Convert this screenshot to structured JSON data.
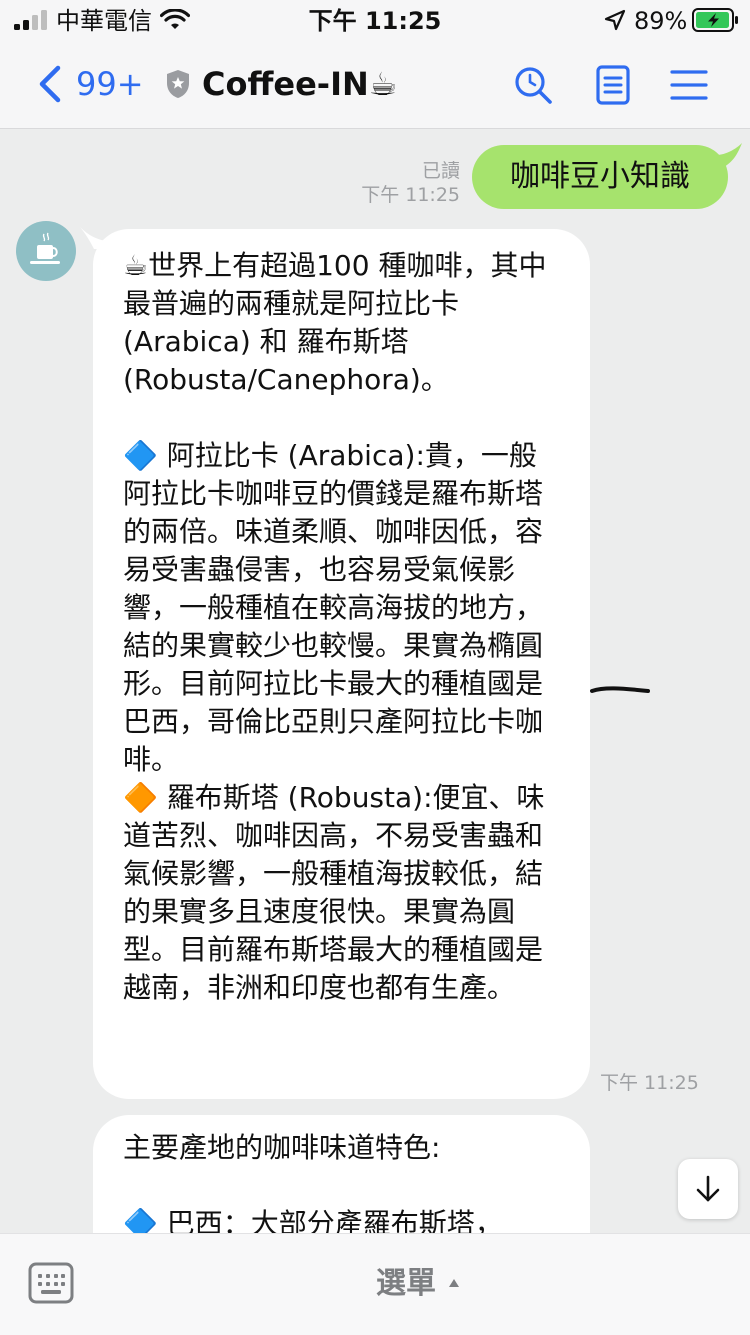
{
  "status_bar": {
    "carrier": "中華電信",
    "time": "下午 11:25",
    "battery_percent": "89%",
    "icons": [
      "signal-icon",
      "wifi-icon",
      "location-arrow-icon",
      "battery-charging-icon"
    ]
  },
  "nav": {
    "unread_count": "99+",
    "chat_title": "Coffee-IN☕",
    "icons": [
      "back-chevron-icon",
      "shield-icon",
      "search-icon",
      "notes-icon",
      "menu-icon"
    ]
  },
  "messages": {
    "outgoing": {
      "read_label": "已讀",
      "time": "下午 11:25",
      "text": "咖啡豆小知識"
    },
    "incoming_1": {
      "text": "☕世界上有超過100 種咖啡，其中最普遍的兩種就是阿拉比卡 (Arabica) 和 羅布斯塔 (Robusta/Canephora)。\n\n🔷 阿拉比卡 (Arabica):貴，一般阿拉比卡咖啡豆的價錢是羅布斯塔的兩倍。味道柔順、咖啡因低，容易受害蟲侵害，也容易受氣候影響，一般種植在較高海拔的地方，結的果實較少也較慢。果實為橢圓形。目前阿拉比卡最大的種植國是巴西，哥倫比亞則只產阿拉比卡咖啡。\n🔶 羅布斯塔 (Robusta):便宜、味道苦烈、咖啡因高，不易受害蟲和氣候影響，一般種植海拔較低，結的果實多且速度很快。果實為圓型。目前羅布斯塔最大的種植國是越南，非洲和印度也都有生產。",
      "time": "下午 11:25"
    },
    "incoming_2": {
      "text": "主要產地的咖啡味道特色:\n\n🔷 巴西：大部分產羅布斯塔，"
    }
  },
  "bottom_bar": {
    "menu_label": "選單",
    "icons": [
      "keyboard-icon",
      "caret-up-icon"
    ]
  },
  "colors": {
    "accent_blue": "#2f6cf0",
    "outgoing_bubble": "#a6e36d",
    "chat_background": "#eceded",
    "meta_text": "#9ea0a3"
  }
}
